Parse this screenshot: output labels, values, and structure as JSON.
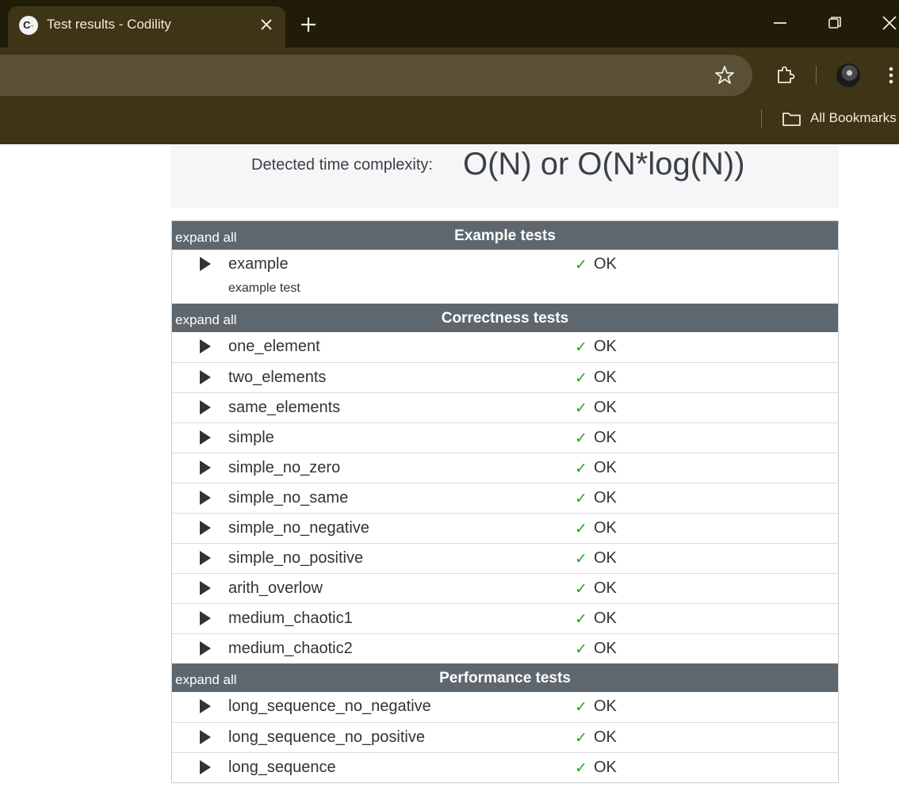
{
  "browser": {
    "tab_title": "Test results - Codility",
    "favicon_letter": "C",
    "favicon_dash": "-",
    "tab_close_icon": "close-icon",
    "new_tab_icon": "plus-icon",
    "bookmarks_label": "All Bookmarks",
    "accent_color": "#3e3416"
  },
  "complexity": {
    "label": "Detected time complexity:",
    "value": "O(N) or O(N*log(N))"
  },
  "groups": [
    {
      "title": "Example tests",
      "expand_label": "expand all",
      "tests": [
        {
          "name": "example",
          "description": "example test",
          "check": "✓",
          "status": "OK"
        }
      ]
    },
    {
      "title": "Correctness tests",
      "expand_label": "expand all",
      "tests": [
        {
          "name": "one_element",
          "check": "✓",
          "status": "OK"
        },
        {
          "name": "two_elements",
          "check": "✓",
          "status": "OK"
        },
        {
          "name": "same_elements",
          "check": "✓",
          "status": "OK"
        },
        {
          "name": "simple",
          "check": "✓",
          "status": "OK"
        },
        {
          "name": "simple_no_zero",
          "check": "✓",
          "status": "OK"
        },
        {
          "name": "simple_no_same",
          "check": "✓",
          "status": "OK"
        },
        {
          "name": "simple_no_negative",
          "check": "✓",
          "status": "OK"
        },
        {
          "name": "simple_no_positive",
          "check": "✓",
          "status": "OK"
        },
        {
          "name": "arith_overlow",
          "check": "✓",
          "status": "OK"
        },
        {
          "name": "medium_chaotic1",
          "check": "✓",
          "status": "OK"
        },
        {
          "name": "medium_chaotic2",
          "check": "✓",
          "status": "OK"
        }
      ]
    },
    {
      "title": "Performance tests",
      "expand_label": "expand all",
      "tests": [
        {
          "name": "long_sequence_no_negative",
          "check": "✓",
          "status": "OK"
        },
        {
          "name": "long_sequence_no_positive",
          "check": "✓",
          "status": "OK"
        },
        {
          "name": "long_sequence",
          "check": "✓",
          "status": "OK"
        }
      ]
    }
  ],
  "colors": {
    "group_header_bg": "#5f676e",
    "ok_check": "#22a622",
    "complexity_bg": "#f5f6f7"
  }
}
